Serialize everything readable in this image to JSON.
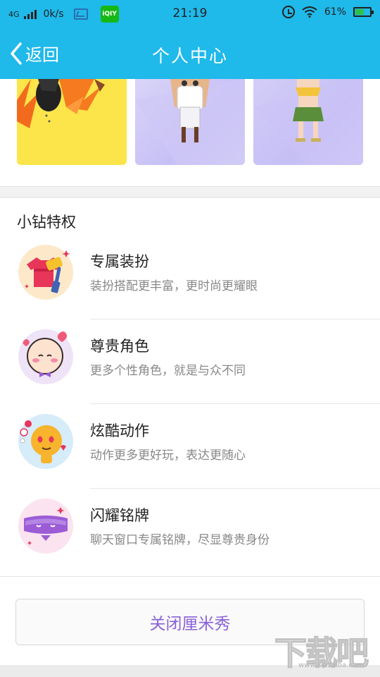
{
  "status_bar": {
    "network": "4G",
    "speed": "0k/s",
    "app_badge": "iQIY",
    "time": "21:19",
    "battery_percent": "61%",
    "battery_level": 0.61
  },
  "nav": {
    "back_label": "返回",
    "title": "个人中心"
  },
  "privileges": {
    "section_title": "小钻特权",
    "items": [
      {
        "title": "专属装扮",
        "subtitle": "装扮搭配更丰富，更时尚更耀眼",
        "icon": "outfit-roller-icon"
      },
      {
        "title": "尊贵角色",
        "subtitle": "更多个性角色，就是与众不同",
        "icon": "character-face-icon"
      },
      {
        "title": "炫酷动作",
        "subtitle": "动作更多更好玩，表达更随心",
        "icon": "heart-eyes-icon"
      },
      {
        "title": "闪耀铭牌",
        "subtitle": "聊天窗口专属铭牌，尽显尊贵身份",
        "icon": "nameplate-icon"
      }
    ]
  },
  "close_button_label": "关闭厘米秀",
  "watermark": {
    "text": "下载吧",
    "url": "www.xiazaiba.com"
  },
  "colors": {
    "header": "#1fb9ea",
    "accent_purple": "#8a62d8",
    "card_yellow": "#fce54a",
    "card_lavender": "#c7c0f5"
  }
}
